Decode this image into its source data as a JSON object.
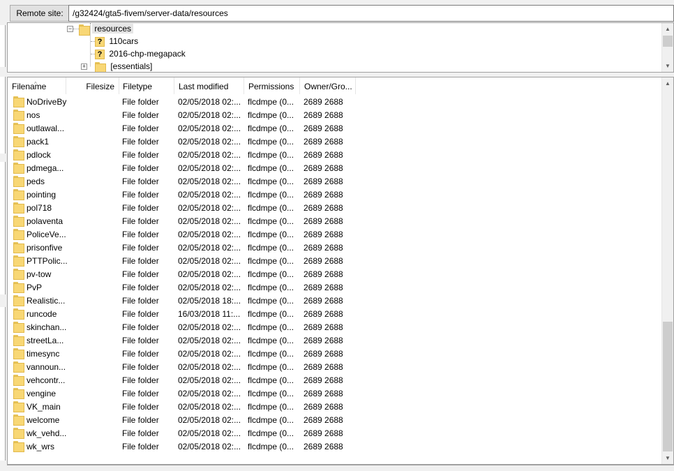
{
  "site_bar": {
    "label": "Remote site:",
    "path": "/g32424/gta5-fivem/server-data/resources"
  },
  "tree": {
    "items": [
      {
        "label": "resources",
        "icon": "folder-icon",
        "selected": true
      },
      {
        "label": "110cars",
        "icon": "unknown-folder-icon"
      },
      {
        "label": "2016-chp-megapack",
        "icon": "unknown-folder-icon"
      },
      {
        "label": "[essentials]",
        "icon": "folder-icon",
        "expandable": true
      }
    ]
  },
  "file_list": {
    "columns": [
      "Filename",
      "Filesize",
      "Filetype",
      "Last modified",
      "Permissions",
      "Owner/Gro..."
    ],
    "rows": [
      {
        "name": "NoDriveBy",
        "type": "File folder",
        "modified": "02/05/2018 02:...",
        "perms": "flcdmpe (0...",
        "owner": "2689 2688"
      },
      {
        "name": "nos",
        "type": "File folder",
        "modified": "02/05/2018 02:...",
        "perms": "flcdmpe (0...",
        "owner": "2689 2688"
      },
      {
        "name": "outlawal...",
        "type": "File folder",
        "modified": "02/05/2018 02:...",
        "perms": "flcdmpe (0...",
        "owner": "2689 2688"
      },
      {
        "name": "pack1",
        "type": "File folder",
        "modified": "02/05/2018 02:...",
        "perms": "flcdmpe (0...",
        "owner": "2689 2688"
      },
      {
        "name": "pdlock",
        "type": "File folder",
        "modified": "02/05/2018 02:...",
        "perms": "flcdmpe (0...",
        "owner": "2689 2688"
      },
      {
        "name": "pdmega...",
        "type": "File folder",
        "modified": "02/05/2018 02:...",
        "perms": "flcdmpe (0...",
        "owner": "2689 2688"
      },
      {
        "name": "peds",
        "type": "File folder",
        "modified": "02/05/2018 02:...",
        "perms": "flcdmpe (0...",
        "owner": "2689 2688"
      },
      {
        "name": "pointing",
        "type": "File folder",
        "modified": "02/05/2018 02:...",
        "perms": "flcdmpe (0...",
        "owner": "2689 2688"
      },
      {
        "name": "pol718",
        "type": "File folder",
        "modified": "02/05/2018 02:...",
        "perms": "flcdmpe (0...",
        "owner": "2689 2688"
      },
      {
        "name": "polaventa",
        "type": "File folder",
        "modified": "02/05/2018 02:...",
        "perms": "flcdmpe (0...",
        "owner": "2689 2688"
      },
      {
        "name": "PoliceVe...",
        "type": "File folder",
        "modified": "02/05/2018 02:...",
        "perms": "flcdmpe (0...",
        "owner": "2689 2688"
      },
      {
        "name": "prisonfive",
        "type": "File folder",
        "modified": "02/05/2018 02:...",
        "perms": "flcdmpe (0...",
        "owner": "2689 2688"
      },
      {
        "name": "PTTPolic...",
        "type": "File folder",
        "modified": "02/05/2018 02:...",
        "perms": "flcdmpe (0...",
        "owner": "2689 2688"
      },
      {
        "name": "pv-tow",
        "type": "File folder",
        "modified": "02/05/2018 02:...",
        "perms": "flcdmpe (0...",
        "owner": "2689 2688"
      },
      {
        "name": "PvP",
        "type": "File folder",
        "modified": "02/05/2018 02:...",
        "perms": "flcdmpe (0...",
        "owner": "2689 2688"
      },
      {
        "name": "Realistic...",
        "type": "File folder",
        "modified": "02/05/2018 18:...",
        "perms": "flcdmpe (0...",
        "owner": "2689 2688"
      },
      {
        "name": "runcode",
        "type": "File folder",
        "modified": "16/03/2018 11:...",
        "perms": "flcdmpe (0...",
        "owner": "2689 2688"
      },
      {
        "name": "skinchan...",
        "type": "File folder",
        "modified": "02/05/2018 02:...",
        "perms": "flcdmpe (0...",
        "owner": "2689 2688"
      },
      {
        "name": "streetLa...",
        "type": "File folder",
        "modified": "02/05/2018 02:...",
        "perms": "flcdmpe (0...",
        "owner": "2689 2688"
      },
      {
        "name": "timesync",
        "type": "File folder",
        "modified": "02/05/2018 02:...",
        "perms": "flcdmpe (0...",
        "owner": "2689 2688"
      },
      {
        "name": "vannoun...",
        "type": "File folder",
        "modified": "02/05/2018 02:...",
        "perms": "flcdmpe (0...",
        "owner": "2689 2688"
      },
      {
        "name": "vehcontr...",
        "type": "File folder",
        "modified": "02/05/2018 02:...",
        "perms": "flcdmpe (0...",
        "owner": "2689 2688"
      },
      {
        "name": "vengine",
        "type": "File folder",
        "modified": "02/05/2018 02:...",
        "perms": "flcdmpe (0...",
        "owner": "2689 2688"
      },
      {
        "name": "VK_main",
        "type": "File folder",
        "modified": "02/05/2018 02:...",
        "perms": "flcdmpe (0...",
        "owner": "2689 2688"
      },
      {
        "name": "welcome",
        "type": "File folder",
        "modified": "02/05/2018 02:...",
        "perms": "flcdmpe (0...",
        "owner": "2689 2688"
      },
      {
        "name": "wk_vehd...",
        "type": "File folder",
        "modified": "02/05/2018 02:...",
        "perms": "flcdmpe (0...",
        "owner": "2689 2688"
      },
      {
        "name": "wk_wrs",
        "type": "File folder",
        "modified": "02/05/2018 02:...",
        "perms": "flcdmpe (0...",
        "owner": "2689 2688"
      }
    ]
  },
  "colors": {
    "folder_fill": "#f8d775",
    "folder_border": "#e2b94b",
    "selection": "#e5e5e5",
    "scroll_thumb": "#cdcdcd"
  }
}
